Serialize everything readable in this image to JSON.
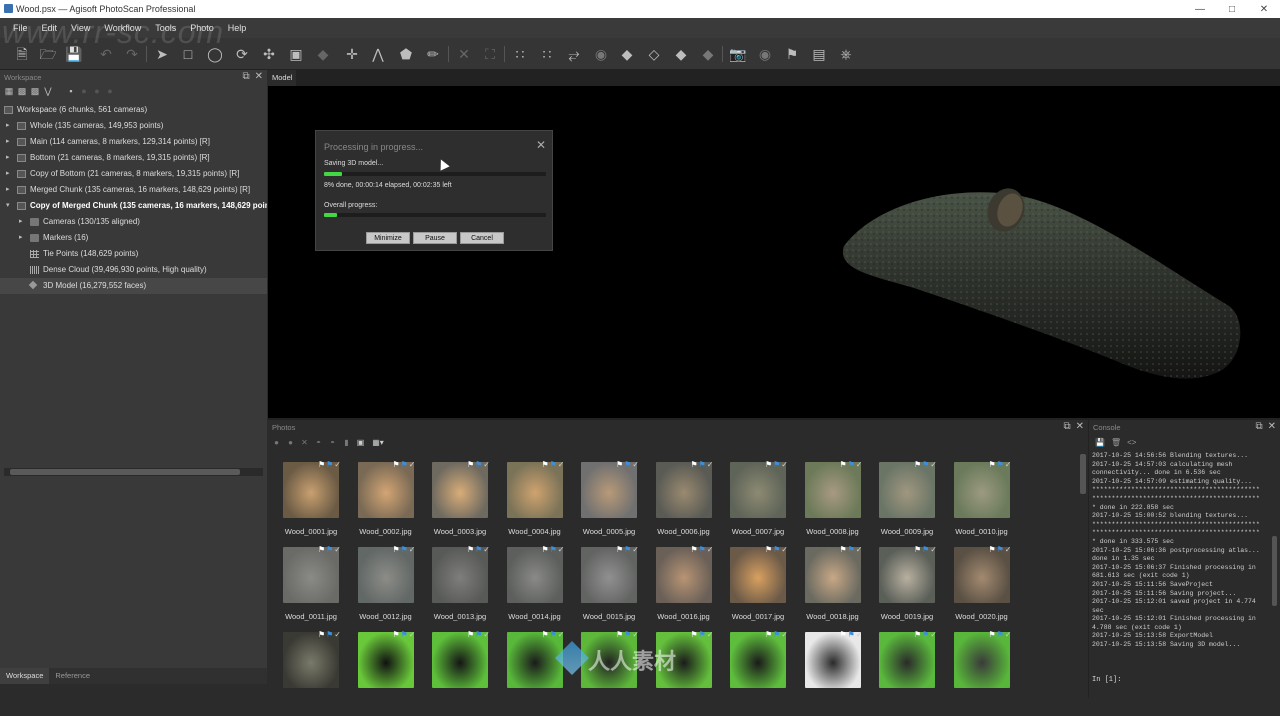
{
  "window": {
    "title": "Wood.psx — Agisoft PhotoScan Professional"
  },
  "menu": [
    "File",
    "Edit",
    "View",
    "Workflow",
    "Tools",
    "Photo",
    "Help"
  ],
  "workspace": {
    "header": "Workspace",
    "tree": [
      {
        "label": "Workspace (6 chunks, 561 cameras)",
        "level": 0,
        "expand": "",
        "icon": "chunk",
        "bold": false,
        "selected": false
      },
      {
        "label": "Whole (135 cameras, 149,953 points)",
        "level": 1,
        "expand": "▸",
        "icon": "chunk",
        "bold": false,
        "selected": false
      },
      {
        "label": "Main (114 cameras, 8 markers, 129,314 points) [R]",
        "level": 1,
        "expand": "▸",
        "icon": "chunk",
        "bold": false,
        "selected": false
      },
      {
        "label": "Bottom (21 cameras, 8 markers, 19,315 points) [R]",
        "level": 1,
        "expand": "▸",
        "icon": "chunk",
        "bold": false,
        "selected": false
      },
      {
        "label": "Copy of Bottom (21 cameras, 8 markers, 19,315 points) [R]",
        "level": 1,
        "expand": "▸",
        "icon": "chunk",
        "bold": false,
        "selected": false
      },
      {
        "label": "Merged Chunk (135 cameras, 16 markers, 148,629 points) [R]",
        "level": 1,
        "expand": "▸",
        "icon": "chunk",
        "bold": false,
        "selected": false
      },
      {
        "label": "Copy of Merged Chunk (135 cameras, 16 markers, 148,629 points)",
        "level": 1,
        "expand": "▾",
        "icon": "chunk",
        "bold": true,
        "selected": false
      },
      {
        "label": "Cameras (130/135 aligned)",
        "level": 2,
        "expand": "▸",
        "icon": "folder",
        "bold": false,
        "selected": false
      },
      {
        "label": "Markers (16)",
        "level": 2,
        "expand": "▸",
        "icon": "folder",
        "bold": false,
        "selected": false
      },
      {
        "label": "Tie Points (148,629 points)",
        "level": 2,
        "expand": "",
        "icon": "tie",
        "bold": false,
        "selected": false
      },
      {
        "label": "Dense Cloud (39,496,930 points, High quality)",
        "level": 2,
        "expand": "",
        "icon": "dense",
        "bold": false,
        "selected": false
      },
      {
        "label": "3D Model (16,279,552 faces)",
        "level": 2,
        "expand": "",
        "icon": "model",
        "bold": false,
        "selected": true
      }
    ]
  },
  "bottom_tabs": [
    "Workspace",
    "Reference"
  ],
  "model": {
    "tab": "Model"
  },
  "dialog": {
    "title": "Processing in progress...",
    "status": "Saving 3D model...",
    "progress_text": "8% done, 00:00:14 elapsed, 00:02:35 left",
    "overall_label": "Overall progress:",
    "progress": 0.08,
    "overall": 0.06,
    "buttons": [
      "Minimize",
      "Pause",
      "Cancel"
    ]
  },
  "photos": {
    "header": "Photos",
    "items": [
      "Wood_0001.jpg",
      "Wood_0002.jpg",
      "Wood_0003.jpg",
      "Wood_0004.jpg",
      "Wood_0005.jpg",
      "Wood_0006.jpg",
      "Wood_0007.jpg",
      "Wood_0008.jpg",
      "Wood_0009.jpg",
      "Wood_0010.jpg",
      "Wood_0011.jpg",
      "Wood_0012.jpg",
      "Wood_0013.jpg",
      "Wood_0014.jpg",
      "Wood_0015.jpg",
      "Wood_0016.jpg",
      "Wood_0017.jpg",
      "Wood_0018.jpg",
      "Wood_0019.jpg",
      "Wood_0020.jpg",
      "",
      "",
      "",
      "",
      "",
      "",
      "",
      "",
      "",
      ""
    ]
  },
  "console": {
    "header": "Console",
    "log": "2017-10-25 14:56:56 Blending textures...\n2017-10-25 14:57:03 calculating mesh\nconnectivity... done in 6.536 sec\n2017-10-25 14:57:09 estimating quality...\n*******************************************\n*******************************************\n* done in 222.858 sec\n2017-10-25 15:00:52 blending textures...\n*******************************************\n*******************************************\n* done in 333.575 sec\n2017-10-25 15:06:36 postprocessing atlas...\ndone in 1.35 sec\n2017-10-25 15:06:37 Finished processing in\n681.613 sec (exit code 1)\n2017-10-25 15:11:56 SaveProject\n2017-10-25 15:11:56 Saving project...\n2017-10-25 15:12:01 saved project in 4.774\nsec\n2017-10-25 15:12:01 Finished processing in\n4.788 sec (exit code 1)\n2017-10-25 15:13:58 ExportModel\n2017-10-25 15:13:58 Saving 3D model...",
    "prompt": "In [1]:"
  },
  "watermark": {
    "site": "www.rr-sc.com",
    "logo": "人人素材"
  },
  "colors": {
    "progress": "#43d843",
    "accent_flag": "#3b8fe0",
    "background": "#2b2b2b"
  }
}
